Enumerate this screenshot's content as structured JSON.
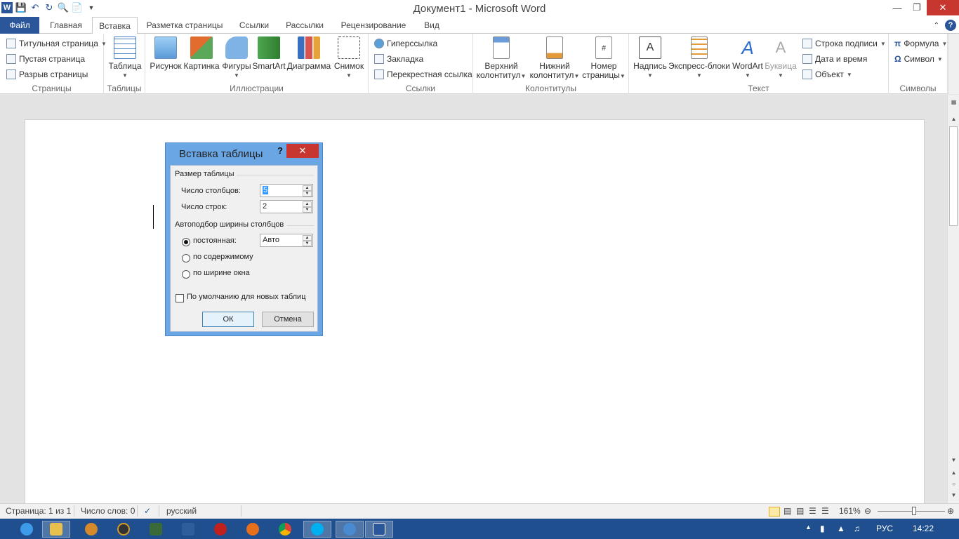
{
  "titlebar": {
    "title": "Документ1 - Microsoft Word",
    "app_logo": "W"
  },
  "tabs": {
    "file": "Файл",
    "items": [
      "Главная",
      "Вставка",
      "Разметка страницы",
      "Ссылки",
      "Рассылки",
      "Рецензирование",
      "Вид"
    ],
    "active": "Вставка"
  },
  "ribbon": {
    "pages": {
      "label": "Страницы",
      "items": [
        "Титульная страница",
        "Пустая страница",
        "Разрыв страницы"
      ]
    },
    "tables": {
      "label": "Таблицы",
      "button": "Таблица"
    },
    "illustrations": {
      "label": "Иллюстрации",
      "items": [
        "Рисунок",
        "Картинка",
        "Фигуры",
        "SmartArt",
        "Диаграмма",
        "Снимок"
      ]
    },
    "links": {
      "label": "Ссылки",
      "items": [
        "Гиперссылка",
        "Закладка",
        "Перекрестная ссылка"
      ]
    },
    "headers": {
      "label": "Колонтитулы",
      "header_1": "Верхний",
      "header_2": "колонтитул",
      "footer_1": "Нижний",
      "footer_2": "колонтитул",
      "pagenum_1": "Номер",
      "pagenum_2": "страницы"
    },
    "text": {
      "label": "Текст",
      "items": [
        "Надпись",
        "Экспресс-блоки",
        "WordArt",
        "Буквица"
      ],
      "small_items": [
        "Строка подписи",
        "Дата и время",
        "Объект"
      ]
    },
    "symbols": {
      "label": "Символы",
      "items": [
        "Формула",
        "Символ"
      ]
    }
  },
  "dialog": {
    "title": "Вставка таблицы",
    "help": "?",
    "close": "✕",
    "size_legend": "Размер таблицы",
    "cols_label": "Число столбцов:",
    "cols_value": "5",
    "rows_label": "Число строк:",
    "rows_value": "2",
    "autofit_legend": "Автоподбор ширины столбцов",
    "fixed_label": "постоянная:",
    "fixed_value": "Авто",
    "content_label": "по содержимому",
    "window_label": "по ширине окна",
    "default_label": "По умолчанию для новых таблиц",
    "ok": "ОК",
    "cancel": "Отмена"
  },
  "statusbar": {
    "page": "Страница: 1 из 1",
    "words": "Число слов: 0",
    "language": "русский",
    "zoom": "161%"
  },
  "taskbar": {
    "lang": "РУС",
    "time": "14:22"
  },
  "colors": {
    "accent": "#2b579a",
    "dialog_frame": "#6aa5e4",
    "close_red": "#c7372f",
    "taskbar": "#1f4f8f"
  }
}
